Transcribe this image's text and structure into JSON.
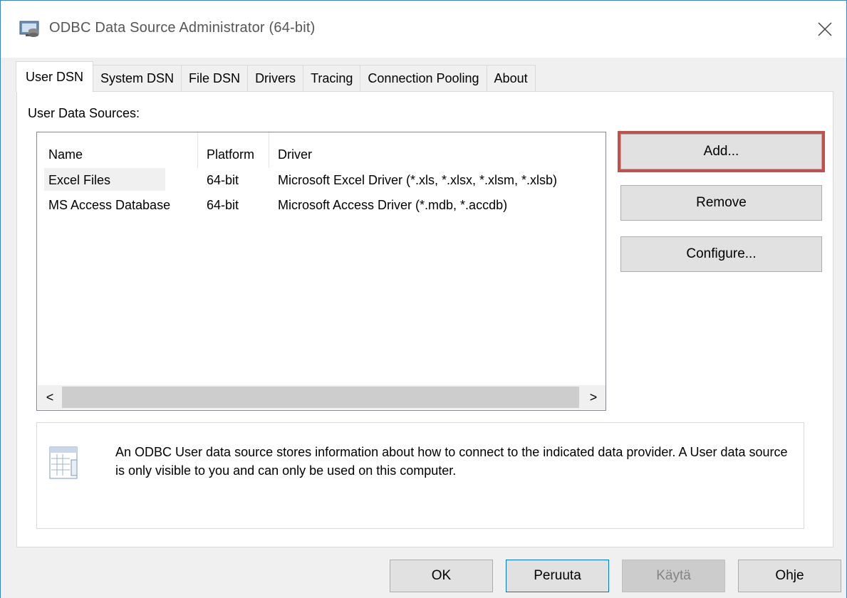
{
  "window": {
    "title": "ODBC Data Source Administrator (64-bit)",
    "close_glyph": "✕"
  },
  "tabs": [
    {
      "label": "User DSN",
      "active": true
    },
    {
      "label": "System DSN",
      "active": false
    },
    {
      "label": "File DSN",
      "active": false
    },
    {
      "label": "Drivers",
      "active": false
    },
    {
      "label": "Tracing",
      "active": false
    },
    {
      "label": "Connection Pooling",
      "active": false
    },
    {
      "label": "About",
      "active": false
    }
  ],
  "user_dsn": {
    "section_label": "User Data Sources:",
    "columns": [
      "Name",
      "Platform",
      "Driver"
    ],
    "rows": [
      {
        "name": "Excel Files",
        "platform": "64-bit",
        "driver": "Microsoft Excel Driver (*.xls, *.xlsx, *.xlsm, *.xlsb)"
      },
      {
        "name": "MS Access Database",
        "platform": "64-bit",
        "driver": "Microsoft Access Driver (*.mdb, *.accdb)"
      }
    ],
    "scroll_left": "<",
    "scroll_right": ">",
    "buttons": {
      "add": "Add...",
      "remove": "Remove",
      "configure": "Configure..."
    },
    "info_text": "An ODBC User data source stores information about how to connect to the indicated data provider.   A User data source is only visible to you and can only be used on this computer."
  },
  "dialog_buttons": {
    "ok": "OK",
    "cancel": "Peruuta",
    "apply": "Käytä",
    "help": "Ohje"
  },
  "colors": {
    "highlight_frame": "#c0504d",
    "window_border": "#3a83d1"
  },
  "icons": {
    "title": "odbc-app-icon",
    "info": "data-source-info-icon"
  }
}
